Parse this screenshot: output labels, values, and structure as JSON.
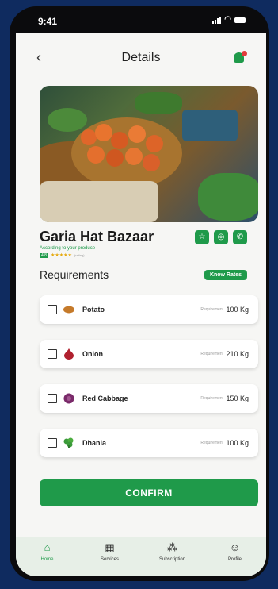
{
  "status_bar": {
    "time": "9:41"
  },
  "header": {
    "title": "Details",
    "back_icon": "chevron-left-icon",
    "bell_icon": "bell-icon"
  },
  "market": {
    "name": "Garia Hat Bazaar",
    "tagline": "According to your produce",
    "rating_value": "4.8",
    "stars": "★★★★★",
    "rating_count": "(rating)"
  },
  "actions": [
    {
      "name": "favorite-icon",
      "glyph": "☆"
    },
    {
      "name": "whatsapp-icon",
      "glyph": "◎"
    },
    {
      "name": "phone-icon",
      "glyph": "✆"
    }
  ],
  "requirements": {
    "title": "Requirements",
    "know_rates_label": "Know Rates",
    "items": [
      {
        "name": "Potato",
        "requirement_label": "Requirement",
        "requirement_value": "100 Kg",
        "icon": "potato-icon",
        "color": "#c57a2a",
        "checked": false
      },
      {
        "name": "Onion",
        "requirement_label": "Requirement",
        "requirement_value": "210 Kg",
        "icon": "onion-icon",
        "color": "#b0202e",
        "checked": false
      },
      {
        "name": "Red Cabbage",
        "requirement_label": "Requirement",
        "requirement_value": "150 Kg",
        "icon": "red-cabbage-icon",
        "color": "#7a2a6a",
        "checked": false
      },
      {
        "name": "Dhania",
        "requirement_label": "Requirement",
        "requirement_value": "100 Kg",
        "icon": "dhania-icon",
        "color": "#3b9a3a",
        "checked": false
      }
    ]
  },
  "confirm_label": "CONFIRM",
  "nav": [
    {
      "label": "Home",
      "icon": "home-icon",
      "glyph": "⌂",
      "active": true
    },
    {
      "label": "Services",
      "icon": "services-icon",
      "glyph": "▦",
      "active": false
    },
    {
      "label": "Subscription",
      "icon": "subscription-icon",
      "glyph": "⁂",
      "active": false
    },
    {
      "label": "Profile",
      "icon": "profile-icon",
      "glyph": "☺",
      "active": false
    }
  ],
  "colors": {
    "accent": "#1f9a4a",
    "background": "#0f2b5f"
  }
}
